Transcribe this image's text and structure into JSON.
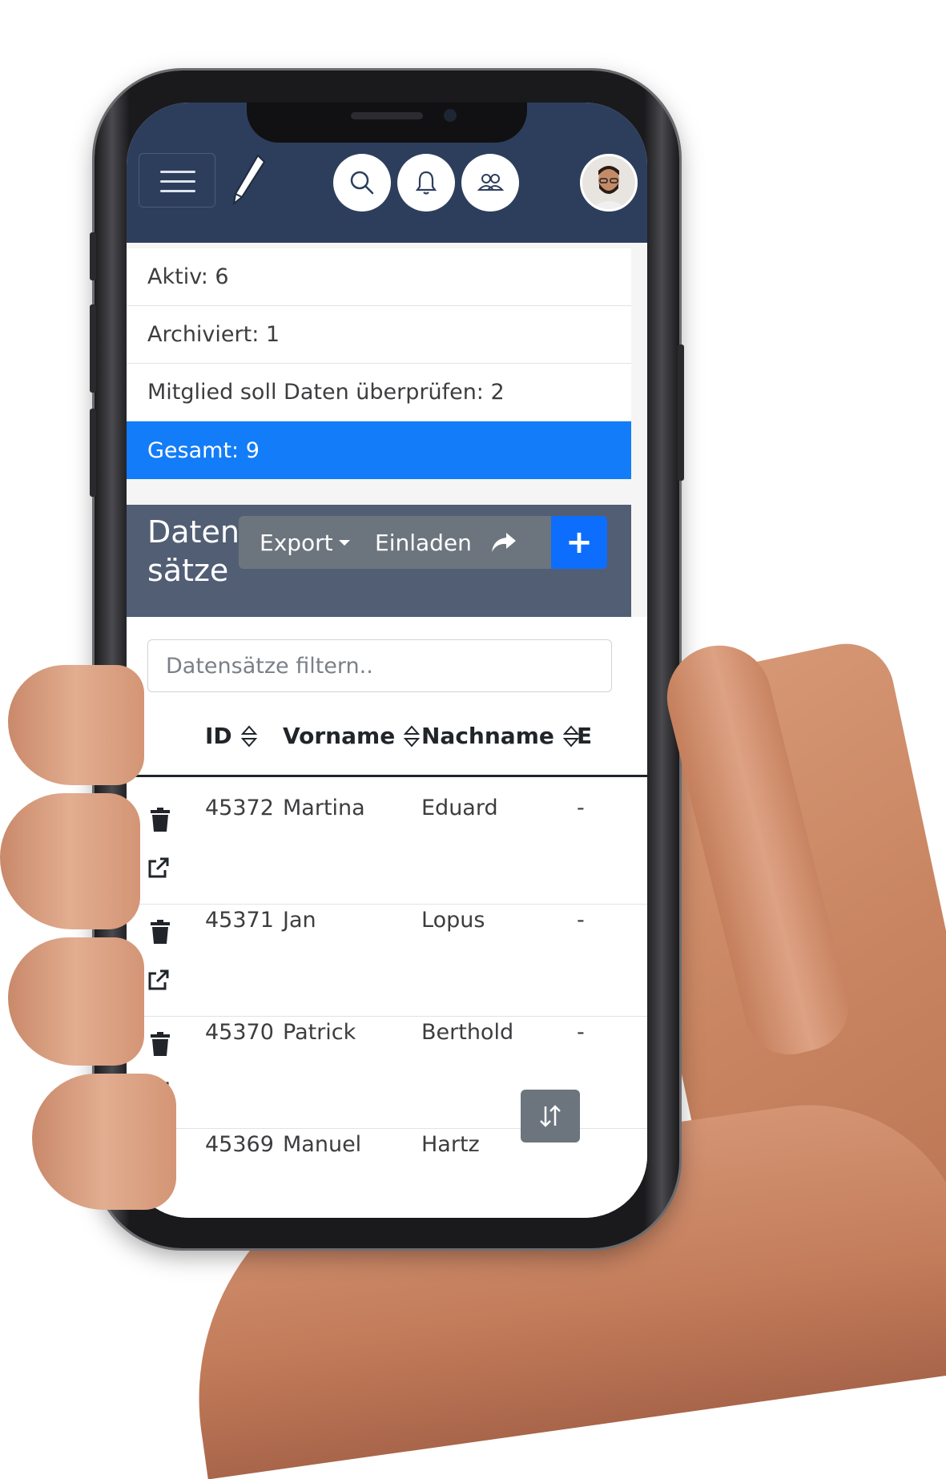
{
  "header": {
    "menu_icon": "hamburger-icon",
    "logo_icon": "pen-icon",
    "actions": [
      "search-icon",
      "bell-icon",
      "users-icon",
      "avatar"
    ]
  },
  "status_list": [
    {
      "label": "Aktiv: 6",
      "active": false
    },
    {
      "label": "Archiviert: 1",
      "active": false
    },
    {
      "label": "Mitglied soll Daten überprüfen: 2",
      "active": false
    },
    {
      "label": "Gesamt: 9",
      "active": true
    }
  ],
  "datasets": {
    "title_line1": "Daten",
    "title_line2": "sätze",
    "export_label": "Export",
    "invite_label": "Einladen",
    "share_icon": "share-icon",
    "add_label": "+"
  },
  "filter": {
    "placeholder": "Datensätze filtern.."
  },
  "table": {
    "columns": [
      "ID",
      "Vorname",
      "Nachname",
      "E"
    ],
    "rows": [
      {
        "id": "45372",
        "first": "Martina",
        "last": "Eduard",
        "extra": "-"
      },
      {
        "id": "45371",
        "first": "Jan",
        "last": "Lopus",
        "extra": "-"
      },
      {
        "id": "45370",
        "first": "Patrick",
        "last": "Berthold",
        "extra": "-"
      },
      {
        "id": "45369",
        "first": "Manuel",
        "last": "Hartz",
        "extra": ""
      }
    ]
  },
  "colors": {
    "header_bg": "#2d3e5d",
    "active_blue": "#137cf8",
    "section_bg": "#515e74",
    "button_gray": "#6c757d",
    "primary": "#0d6efd"
  }
}
